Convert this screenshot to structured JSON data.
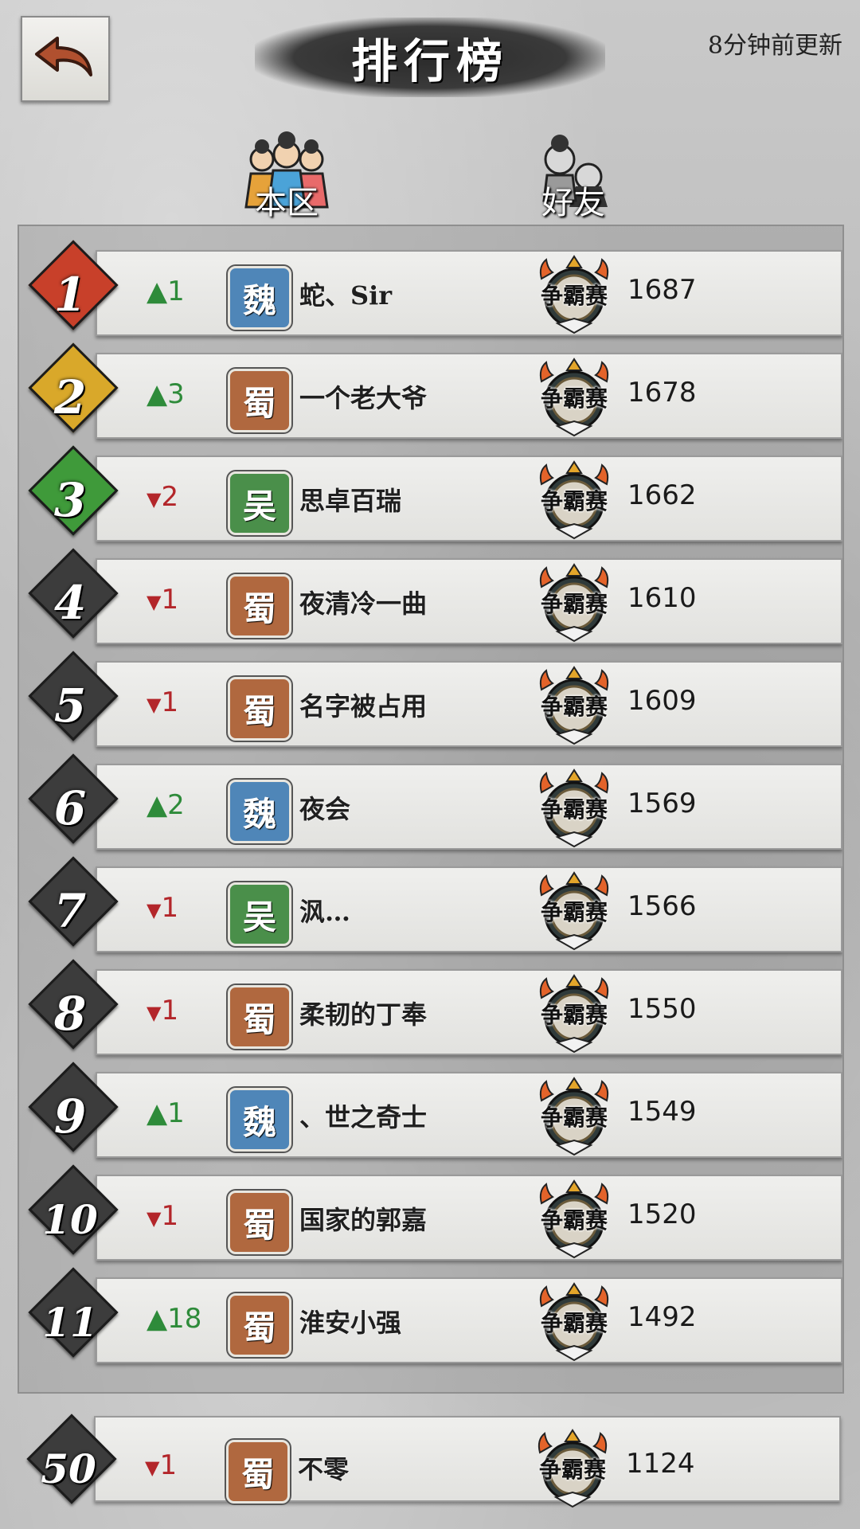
{
  "header": {
    "title": "排行榜",
    "update_time": "8分钟前更新"
  },
  "tabs": [
    {
      "label": "本区",
      "active": true
    },
    {
      "label": "好友",
      "active": false
    }
  ],
  "badge_label": "争霸赛",
  "kingdom_colors": {
    "魏": "#4f86b8",
    "蜀": "#b0683f",
    "吴": "#4a8f4a"
  },
  "rank_colors": {
    "1": "#c8402a",
    "2": "#d9a82a",
    "3": "#3f9a3a",
    "default": "#3c3c3c"
  },
  "rows": [
    {
      "rank": "1",
      "change": "1",
      "dir": "up",
      "kingdom": "魏",
      "name": "蛇、Sir",
      "score": "1687"
    },
    {
      "rank": "2",
      "change": "3",
      "dir": "up",
      "kingdom": "蜀",
      "name": "一个老大爷",
      "score": "1678"
    },
    {
      "rank": "3",
      "change": "2",
      "dir": "down",
      "kingdom": "吴",
      "name": "思卓百瑞",
      "score": "1662"
    },
    {
      "rank": "4",
      "change": "1",
      "dir": "down",
      "kingdom": "蜀",
      "name": "夜清冷一曲",
      "score": "1610"
    },
    {
      "rank": "5",
      "change": "1",
      "dir": "down",
      "kingdom": "蜀",
      "name": "名字被占用",
      "score": "1609"
    },
    {
      "rank": "6",
      "change": "2",
      "dir": "up",
      "kingdom": "魏",
      "name": "夜会",
      "score": "1569"
    },
    {
      "rank": "7",
      "change": "1",
      "dir": "down",
      "kingdom": "吴",
      "name": "沨…",
      "score": "1566"
    },
    {
      "rank": "8",
      "change": "1",
      "dir": "down",
      "kingdom": "蜀",
      "name": "柔韧的丁奉",
      "score": "1550"
    },
    {
      "rank": "9",
      "change": "1",
      "dir": "up",
      "kingdom": "魏",
      "name": "、世之奇士",
      "score": "1549"
    },
    {
      "rank": "10",
      "change": "1",
      "dir": "down",
      "kingdom": "蜀",
      "name": "国家的郭嘉",
      "score": "1520"
    },
    {
      "rank": "11",
      "change": "18",
      "dir": "up",
      "kingdom": "蜀",
      "name": "淮安小强",
      "score": "1492"
    }
  ],
  "my_row": {
    "rank": "50",
    "change": "1",
    "dir": "down",
    "kingdom": "蜀",
    "name": "不零",
    "score": "1124"
  }
}
